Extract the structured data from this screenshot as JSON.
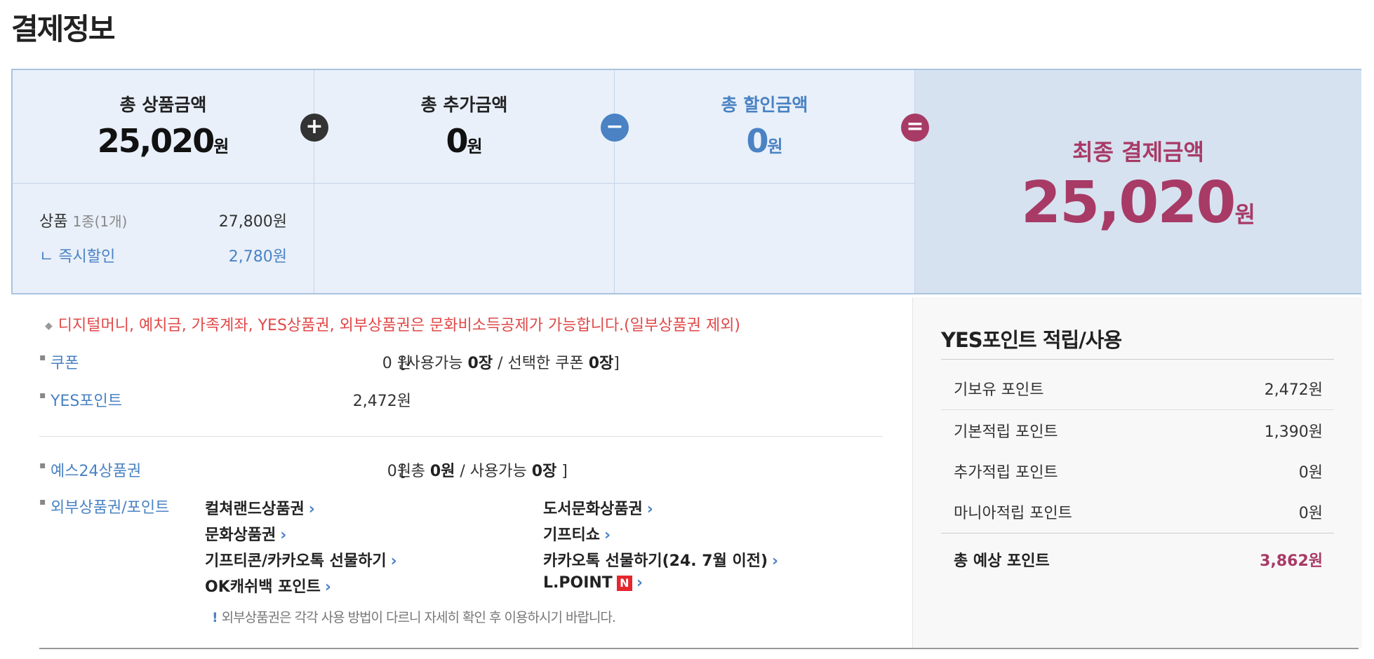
{
  "page_title": "결제정보",
  "summary": {
    "product_total": {
      "label": "총 상품금액",
      "value": "25,020",
      "unit": "원"
    },
    "extra_total": {
      "label": "총 추가금액",
      "value": "0",
      "unit": "원"
    },
    "discount_total": {
      "label": "총 할인금액",
      "value": "0",
      "unit": "원"
    },
    "operators": {
      "plus": "+",
      "minus": "−",
      "equals": "="
    },
    "details": {
      "product_label": "상품",
      "product_count": "1종(1개)",
      "product_value": "27,800원",
      "instant_discount_label": "ㄴ 즉시할인",
      "instant_discount_value": "2,780원"
    },
    "final": {
      "label": "최종 결제금액",
      "value": "25,020",
      "unit": "원"
    }
  },
  "notice": "디지털머니, 예치금, 가족계좌, YES상품권, 외부상품권은 문화비소득공제가 가능합니다.(일부상품권 제외)",
  "payment": {
    "coupon": {
      "label": "쿠폰",
      "value": "0 원",
      "info_prefix": "[사용가능 ",
      "info_available": "0장",
      "info_mid": " / 선택한 쿠폰 ",
      "info_selected": "0장",
      "info_suffix": "]"
    },
    "yes_point": {
      "label": "YES포인트",
      "value": "2,472원"
    },
    "yes24_voucher": {
      "label": "예스24상품권",
      "value": "0원",
      "info_prefix": "[ 총 ",
      "info_total": "0원",
      "info_mid": " / 사용가능 ",
      "info_available": "0장",
      "info_suffix": " ]"
    },
    "external": {
      "label": "외부상품권/포인트",
      "links": [
        "컬쳐랜드상품권",
        "도서문화상품권",
        "문화상품권",
        "기프티쇼",
        "기프티콘/카카오톡 선물하기",
        "카카오톡 선물하기(24. 7월 이전)",
        "OK캐쉬백 포인트",
        "L.POINT"
      ],
      "npay_badge": "N",
      "warning": "외부상품권은 각각 사용 방법이 다르니 자세히 확인 후 이용하시기 바랍니다."
    }
  },
  "points_panel": {
    "title": "YES포인트 적립/사용",
    "rows": [
      {
        "label": "기보유 포인트",
        "value": "2,472원"
      },
      {
        "label": "기본적립 포인트",
        "value": "1,390원"
      },
      {
        "label": "추가적립 포인트",
        "value": "0원"
      },
      {
        "label": "마니아적립 포인트",
        "value": "0원"
      }
    ],
    "total": {
      "label": "총 예상 포인트",
      "value": "3,862원"
    }
  },
  "colors": {
    "accent_blue": "#4a82c3",
    "final_red": "#a83a66",
    "notice_red": "#e04848"
  }
}
